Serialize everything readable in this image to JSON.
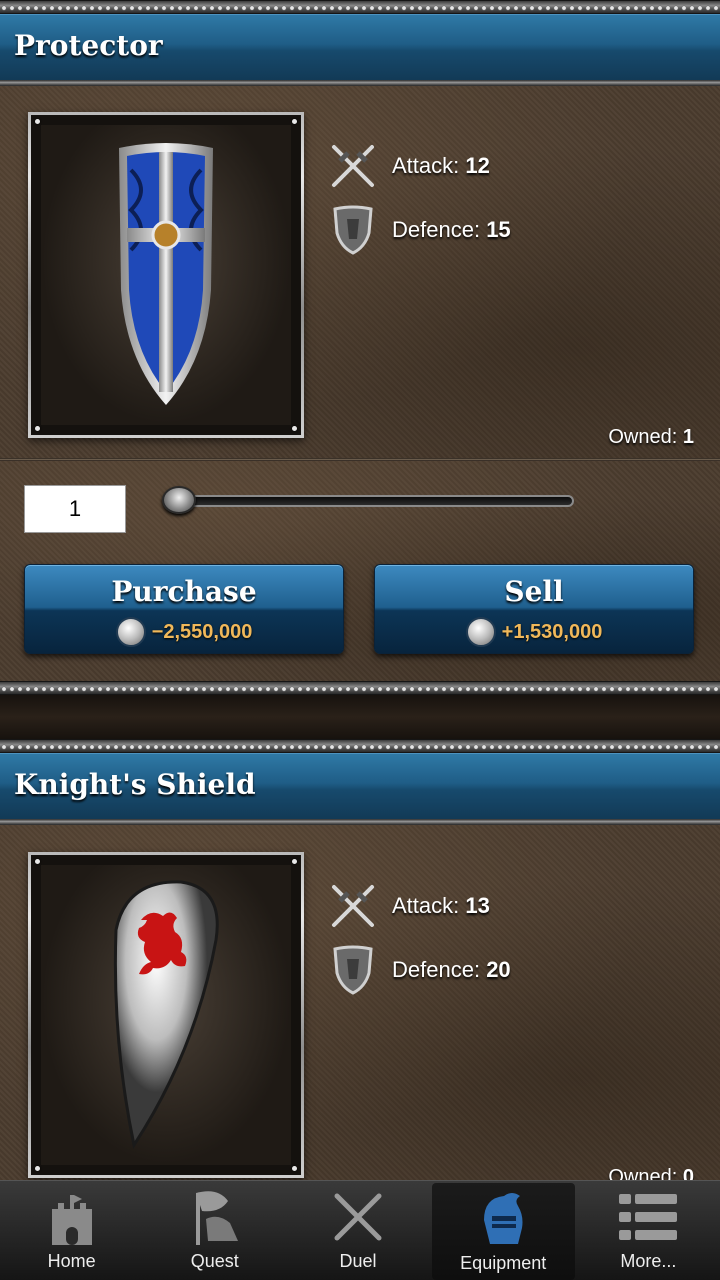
{
  "items": [
    {
      "name": "Protector",
      "attack_label": "Attack:",
      "attack": "12",
      "defence_label": "Defence:",
      "defence": "15",
      "owned_label": "Owned:",
      "owned": "1",
      "quantity": "1",
      "purchase_label": "Purchase",
      "purchase_price": "−2,550,000",
      "sell_label": "Sell",
      "sell_price": "+1,530,000",
      "image_icon": "blue-cross-shield-icon"
    },
    {
      "name": "Knight's Shield",
      "attack_label": "Attack:",
      "attack": "13",
      "defence_label": "Defence:",
      "defence": "20",
      "owned_label": "Owned:",
      "owned": "0",
      "image_icon": "red-lion-kite-shield-icon"
    }
  ],
  "tabbar": {
    "tabs": [
      {
        "label": "Home",
        "icon": "castle-icon"
      },
      {
        "label": "Quest",
        "icon": "quest-flag-icon"
      },
      {
        "label": "Duel",
        "icon": "crossed-swords-icon"
      },
      {
        "label": "Equipment",
        "icon": "knight-helmet-icon",
        "active": true
      },
      {
        "label": "More...",
        "icon": "list-icon"
      }
    ]
  },
  "colors": {
    "title_bar": "#1f5d86",
    "price_text": "#f0b85a",
    "active_tab_icon": "#2f6fb5"
  }
}
